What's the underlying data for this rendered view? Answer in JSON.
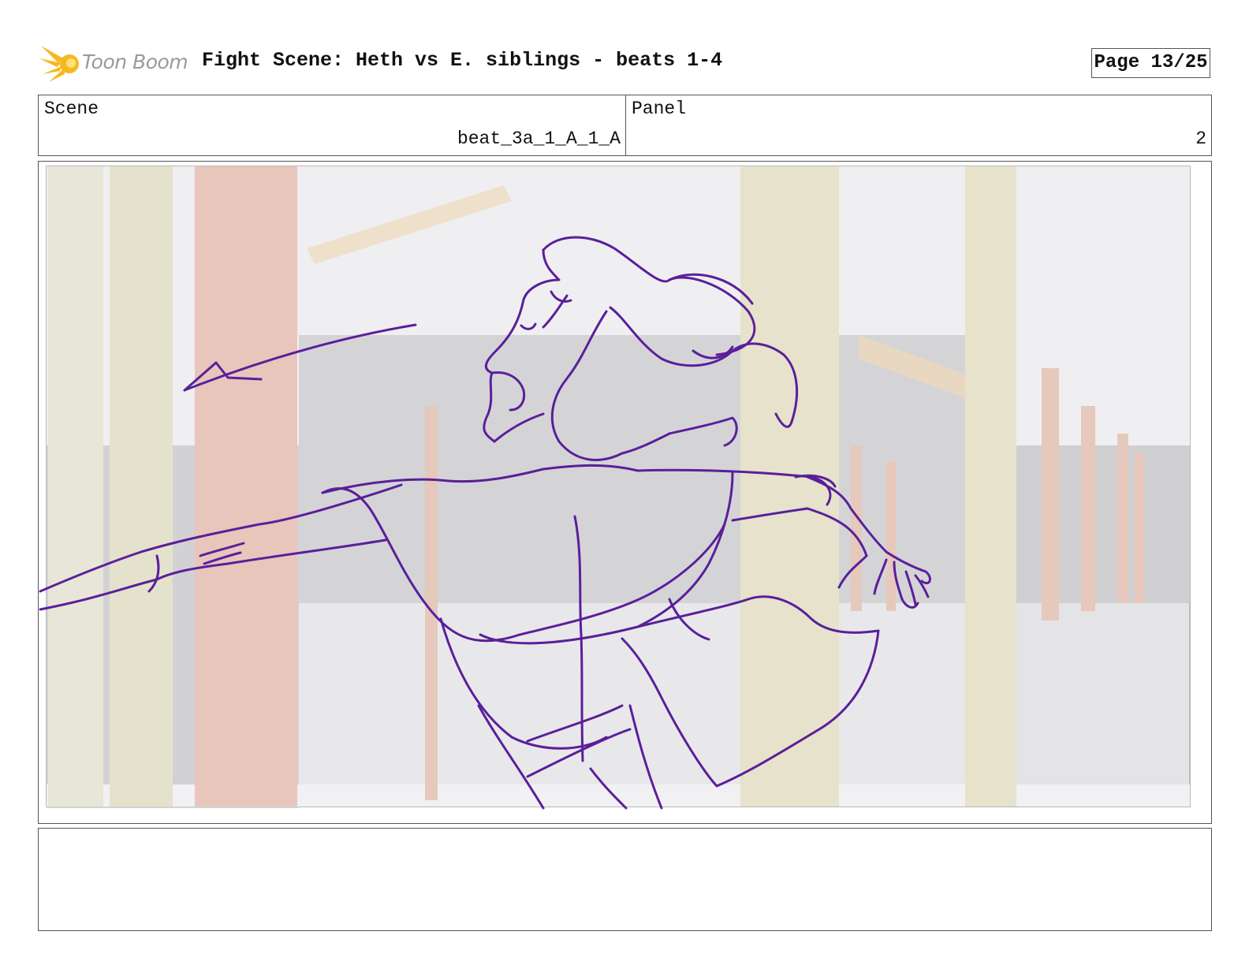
{
  "header": {
    "logo_text": "Toon Boom",
    "title": "Fight Scene: Heth vs E. siblings - beats 1-4",
    "page": "Page 13/25"
  },
  "info": {
    "scene_label": "Scene",
    "scene_value": "beat_3a_1_A_1_A",
    "panel_label": "Panel",
    "panel_value": "2"
  },
  "colors": {
    "sketch": "#5a1f9a",
    "logo": "#f5b820",
    "border": "#555555"
  },
  "icons": {
    "logo": "toon-boom-burst-icon"
  },
  "notes": {
    "text": ""
  }
}
